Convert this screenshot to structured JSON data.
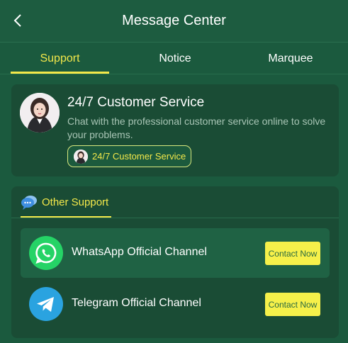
{
  "header": {
    "title": "Message Center",
    "back_icon": "chevron-left-icon"
  },
  "tabs": [
    {
      "label": "Support",
      "active": true
    },
    {
      "label": "Notice",
      "active": false
    },
    {
      "label": "Marquee",
      "active": false
    }
  ],
  "customer_service": {
    "title": "24/7 Customer Service",
    "description": "Chat with the professional customer service online to solve your problems.",
    "button_label": "24/7 Customer Service"
  },
  "other_support": {
    "title": "Other Support",
    "icon": "chat-bubble-icon",
    "channels": [
      {
        "name": "WhatsApp Official Channel",
        "icon": "whatsapp-icon",
        "action": "Contact Now"
      },
      {
        "name": "Telegram Official Channel",
        "icon": "telegram-icon",
        "action": "Contact Now"
      }
    ]
  },
  "colors": {
    "background": "#1b5a3e",
    "card": "#1a4c35",
    "accent": "#f3e84a",
    "button": "#f6f04a",
    "whatsapp": "#25d366",
    "telegram": "#2aa3e0"
  }
}
